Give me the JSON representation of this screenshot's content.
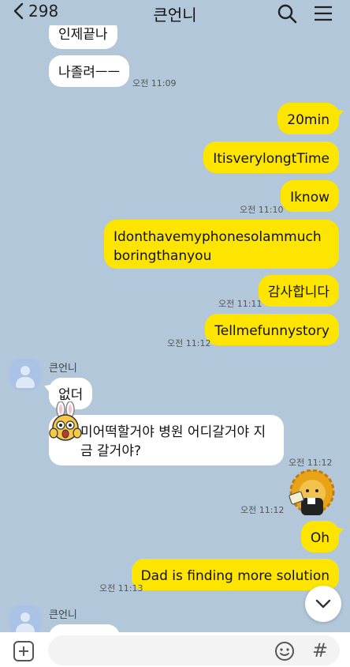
{
  "header": {
    "back_count": "298",
    "title": "큰언니"
  },
  "messages": [
    {
      "id": "m0",
      "text": "인제끝나"
    },
    {
      "id": "m1",
      "text": "나졸려ㅡㅡ",
      "time": "오전 11:09"
    },
    {
      "id": "m2",
      "text": "20min"
    },
    {
      "id": "m3",
      "text": "ItisverylongtTime"
    },
    {
      "id": "m4",
      "text": "Iknow",
      "time": "오전 11:10"
    },
    {
      "id": "m5",
      "text": "Idonthavemyphonesolammuchboringthanyou"
    },
    {
      "id": "m6",
      "text": "감사합니다",
      "time": "오전 11:11"
    },
    {
      "id": "m7",
      "text": "Tellmefunnystory",
      "time": "오전 11:12"
    },
    {
      "id": "m8",
      "sender": "큰언니",
      "text": "없더"
    },
    {
      "id": "m9",
      "text": "미어떡할거야 병원 어디갈거야 지금 갈거야?",
      "time": "오전 11:12"
    },
    {
      "id": "m10",
      "time": "오전 11:12"
    },
    {
      "id": "m11",
      "text": "Oh"
    },
    {
      "id": "m12",
      "text": "Dad is finding more solution",
      "time": "오전 11:13"
    },
    {
      "id": "m13",
      "sender": "큰언니"
    }
  ],
  "input": {
    "placeholder": ""
  },
  "colors": {
    "background": "#b2c7d9",
    "outgoing_bubble": "#fee500",
    "incoming_bubble": "#ffffff"
  },
  "icons": {
    "back": "chevron-left-icon",
    "search": "search-icon",
    "menu": "hamburger-menu-icon",
    "add": "plus-icon",
    "emoji": "smiley-icon",
    "hash": "hash-icon",
    "scroll_down": "chevron-down-icon"
  }
}
